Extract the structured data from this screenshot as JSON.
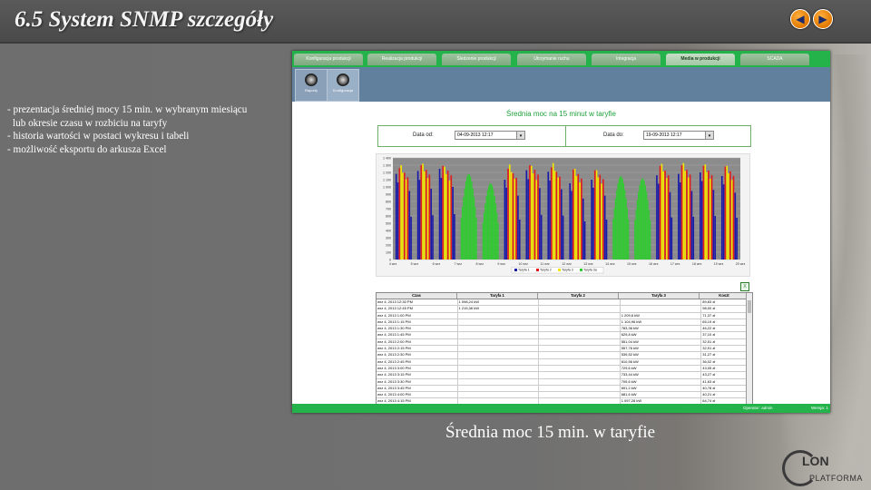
{
  "slide": {
    "title": "6.5 System SNMP szczegóły",
    "bullets": [
      "- prezentacja średniej mocy 15 min.  w wybranym miesiącu",
      "  lub okresie czasu w rozbiciu na taryfy",
      "- historia wartości w postaci wykresu i tabeli",
      "- możliwość eksportu do arkusza Excel"
    ],
    "caption": "Średnia moc 15 min. w taryfie",
    "logo": {
      "main": "LON",
      "sub": "PLATFORMA"
    },
    "nav": {
      "prev": "◀",
      "next": "▶"
    }
  },
  "app": {
    "tabs": [
      "Konfiguracja produkcji",
      "Realizacja produkcji",
      "Śledzenie produkcji",
      "Utrzymanie ruchu",
      "Integracja",
      "Media w produkcji",
      "SCADA"
    ],
    "active_tab": 5,
    "tools": [
      "Raporty",
      "Konfiguracja"
    ],
    "content_title": "Średnia moc na 15 minut w taryfie",
    "date_from_label": "Data od:",
    "date_from": "04-09-2013 12:17",
    "date_to_label": "Data do:",
    "date_to": "19-09-2013 12:17",
    "excel_icon": "excel-icon",
    "status_operator": "Operator: admin",
    "status_version": "Wersja: 1"
  },
  "chart_data": {
    "type": "bar",
    "y_ticks": [
      "1 400",
      "1 300",
      "1 200",
      "1 100",
      "1 000",
      "900",
      "800",
      "700",
      "600",
      "500",
      "400",
      "300",
      "200",
      "100",
      "0"
    ],
    "ylim": [
      0,
      1400
    ],
    "x_ticks": [
      "4 wrz",
      "5 wrz",
      "6 wrz",
      "7 wrz",
      "8 wrz",
      "9 wrz",
      "10 wrz",
      "11 wrz",
      "12 wrz",
      "13 wrz",
      "14 wrz",
      "15 wrz",
      "16 wrz",
      "17 wrz",
      "18 wrz",
      "19 wrz",
      "20 wrz"
    ],
    "legend": [
      "Taryfa 1",
      "Taryfa 2",
      "Taryfa 3",
      "Taryfa 3a"
    ],
    "colors": {
      "Taryfa 1": "#1a1aa8",
      "Taryfa 2": "#e31b1b",
      "Taryfa 3": "#f2e600",
      "Taryfa 3a": "#2ecc2e"
    },
    "grid": true,
    "days": [
      {
        "day": "4 wrz",
        "t1": 1180,
        "t2": 1260,
        "t3": 1300,
        "t3a": 0
      },
      {
        "day": "5 wrz",
        "t1": 1220,
        "t2": 1300,
        "t3": 1320,
        "t3a": 0
      },
      {
        "day": "6 wrz",
        "t1": 1250,
        "t2": 1290,
        "t3": 1280,
        "t3a": 0
      },
      {
        "day": "7 wrz",
        "t1": 0,
        "t2": 0,
        "t3": 0,
        "t3a": 1180
      },
      {
        "day": "8 wrz",
        "t1": 0,
        "t2": 0,
        "t3": 0,
        "t3a": 1050
      },
      {
        "day": "9 wrz",
        "t1": 1100,
        "t2": 1250,
        "t3": 1310,
        "t3a": 0
      },
      {
        "day": "10 wrz",
        "t1": 1230,
        "t2": 1300,
        "t3": 1290,
        "t3a": 0
      },
      {
        "day": "11 wrz",
        "t1": 1210,
        "t2": 1270,
        "t3": 1330,
        "t3a": 0
      },
      {
        "day": "12 wrz",
        "t1": 1050,
        "t2": 1240,
        "t3": 1250,
        "t3a": 0
      },
      {
        "day": "13 wrz",
        "t1": 1100,
        "t2": 1230,
        "t3": 1230,
        "t3a": 0
      },
      {
        "day": "14 wrz",
        "t1": 0,
        "t2": 0,
        "t3": 0,
        "t3a": 1150
      },
      {
        "day": "15 wrz",
        "t1": 0,
        "t2": 0,
        "t3": 0,
        "t3a": 1120
      },
      {
        "day": "16 wrz",
        "t1": 1160,
        "t2": 1290,
        "t3": 1320,
        "t3a": 0
      },
      {
        "day": "17 wrz",
        "t1": 1180,
        "t2": 1300,
        "t3": 1330,
        "t3a": 0
      },
      {
        "day": "18 wrz",
        "t1": 1200,
        "t2": 1290,
        "t3": 1310,
        "t3a": 0
      },
      {
        "day": "19 wrz",
        "t1": 1150,
        "t2": 1280,
        "t3": 1290,
        "t3a": 0
      }
    ]
  },
  "table": {
    "headers": [
      "Czas",
      "Taryfa 1",
      "Taryfa 2",
      "Taryfa 3",
      "Koszt"
    ],
    "rows": [
      [
        "wrz 4, 2013 12:30 PM",
        "1 098,24 kW",
        "",
        "",
        "89,83 zł"
      ],
      [
        "wrz 4, 2013 12:45 PM",
        "1 215,36 kW",
        "",
        "",
        "98,00 zł"
      ],
      [
        "wrz 4, 2013 1:00 PM",
        "",
        "",
        "1 209,6 kW",
        "71,37 zł"
      ],
      [
        "wrz 4, 2013 1:15 PM",
        "",
        "",
        "1 104,96 kW",
        "65,19 zł"
      ],
      [
        "wrz 4, 2013 1:30 PM",
        "",
        "",
        "783,36 kW",
        "46,22 zł"
      ],
      [
        "wrz 4, 2013 1:45 PM",
        "",
        "",
        "629,8 kW",
        "37,10 zł"
      ],
      [
        "wrz 4, 2013 2:00 PM",
        "",
        "",
        "551,04 kW",
        "32,51 zł"
      ],
      [
        "wrz 4, 2013 2:15 PM",
        "",
        "",
        "557,76 kW",
        "32,91 zł"
      ],
      [
        "wrz 4, 2013 2:30 PM",
        "",
        "",
        "539,52 kW",
        "31,27 zł"
      ],
      [
        "wrz 4, 2013 2:45 PM",
        "",
        "",
        "610,56 kW",
        "36,02 zł"
      ],
      [
        "wrz 4, 2013 3:00 PM",
        "",
        "",
        "729,6 kW",
        "43,05 zł"
      ],
      [
        "wrz 4, 2013 3:15 PM",
        "",
        "",
        "733,44 kW",
        "43,27 zł"
      ],
      [
        "wrz 4, 2013 3:30 PM",
        "",
        "",
        "705,6 kW",
        "41,63 zł"
      ],
      [
        "wrz 4, 2013 3:45 PM",
        "",
        "",
        "691,2 kW",
        "40,78 zł"
      ],
      [
        "wrz 4, 2013 4:00 PM",
        "",
        "",
        "681,6 kW",
        "40,21 zł"
      ],
      [
        "wrz 4, 2013 4:15 PM",
        "",
        "",
        "1 097,28 kW",
        "64,74 zł"
      ]
    ]
  }
}
